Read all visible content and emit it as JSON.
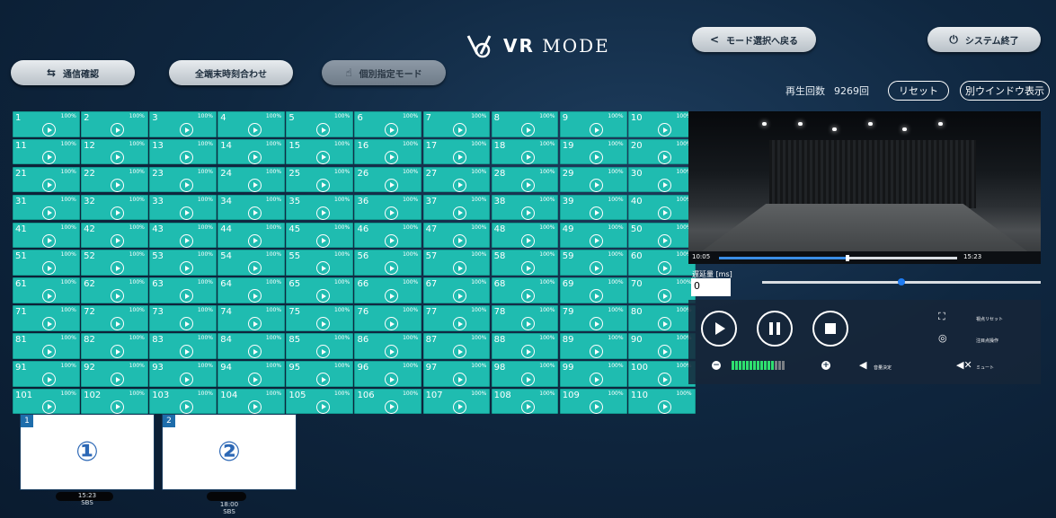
{
  "header": {
    "logo_text_bold": "VR",
    "logo_text": "MODE",
    "back_label": "モード選択へ戻る",
    "exit_label": "システム終了",
    "comm_check_label": "通信確認",
    "time_sync_label": "全端末時刻合わせ",
    "individual_label": "個別指定モード",
    "play_count_label": "再生回数",
    "play_count_value": "9269回",
    "reset_label": "リセット",
    "window_label": "別ウインドウ表示"
  },
  "grid": {
    "percent": "100%",
    "cells": [
      "1",
      "2",
      "3",
      "4",
      "5",
      "6",
      "7",
      "8",
      "9",
      "10",
      "11",
      "12",
      "13",
      "14",
      "15",
      "16",
      "17",
      "18",
      "19",
      "20",
      "21",
      "22",
      "23",
      "24",
      "25",
      "26",
      "27",
      "28",
      "29",
      "30",
      "31",
      "32",
      "33",
      "34",
      "35",
      "36",
      "37",
      "38",
      "39",
      "40",
      "41",
      "42",
      "43",
      "44",
      "45",
      "46",
      "47",
      "48",
      "49",
      "50",
      "51",
      "52",
      "53",
      "54",
      "55",
      "56",
      "57",
      "58",
      "59",
      "60",
      "61",
      "62",
      "63",
      "64",
      "65",
      "66",
      "67",
      "68",
      "69",
      "70",
      "71",
      "72",
      "73",
      "74",
      "75",
      "76",
      "77",
      "78",
      "79",
      "80",
      "81",
      "82",
      "83",
      "84",
      "85",
      "86",
      "87",
      "88",
      "89",
      "90",
      "91",
      "92",
      "93",
      "94",
      "95",
      "96",
      "97",
      "98",
      "99",
      "100",
      "101",
      "102",
      "103",
      "104",
      "105",
      "106",
      "107",
      "108",
      "109",
      "110"
    ]
  },
  "player": {
    "current_time": "10:05",
    "total_time": "15:23",
    "progress": 0.54,
    "delay_label": "遅延量 [ms]",
    "delay_value": "0",
    "delay_slider": 0.5,
    "view_reset_label": "視点リセット",
    "focus_label": "注目点操作",
    "volume_set_label": "音量決定",
    "mute_label": "ミュート",
    "volume_level": 12,
    "volume_max": 15
  },
  "thumbnails": [
    {
      "index": "1",
      "glyph": "①",
      "time": "15:23",
      "format": "SBS"
    },
    {
      "index": "2",
      "glyph": "②",
      "time": "18:00",
      "format": "SBS"
    }
  ],
  "colors": {
    "cell": "#1fbcb0",
    "accent": "#1f7cf2",
    "volume": "#2ee06f"
  }
}
